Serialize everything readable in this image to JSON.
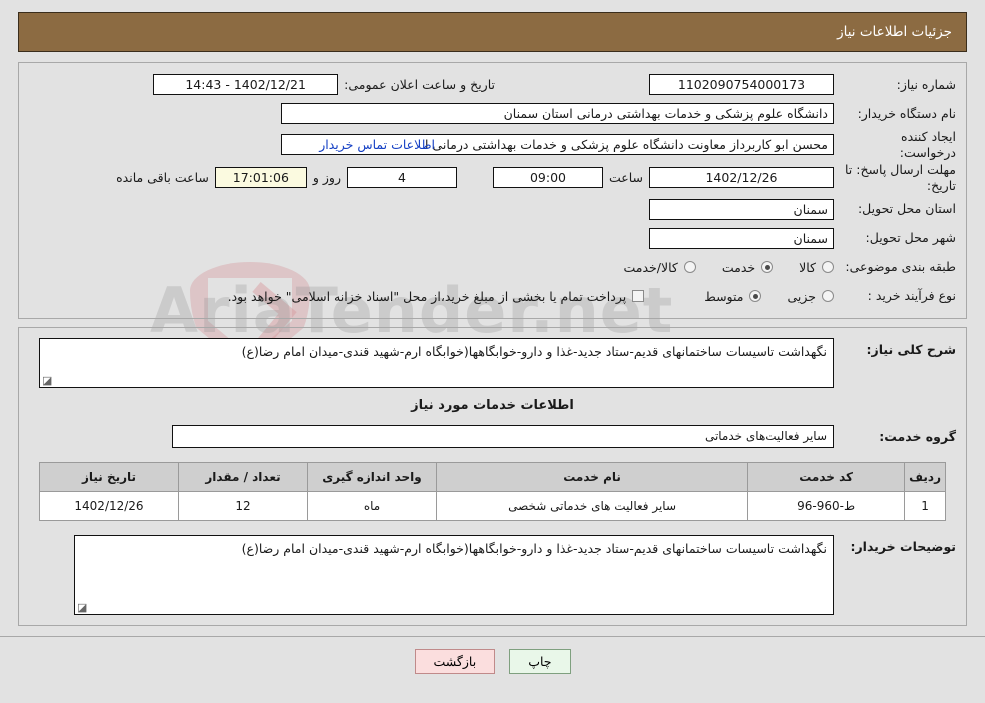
{
  "header": {
    "title": "جزئیات اطلاعات نیاز"
  },
  "top_form": {
    "need_number": {
      "label": "شماره نیاز:",
      "value": "1102090754000173"
    },
    "announce_datetime": {
      "label": "تاریخ و ساعت اعلان عمومی:",
      "value": "1402/12/21 - 14:43"
    },
    "buyer_org": {
      "label": "نام دستگاه خریدار:",
      "value": "دانشگاه علوم پزشکی و خدمات بهداشتی  درمانی استان سمنان"
    },
    "creator": {
      "label": "ایجاد کننده درخواست:",
      "value": "محسن ابو کاربرداز معاونت  دانشگاه علوم پزشکی و خدمات بهداشتی  درمانی ا",
      "contact_link": "اطلاعات تماس خریدار"
    },
    "deadline": {
      "label": "مهلت ارسال پاسخ: تا تاریخ:",
      "date": "1402/12/26",
      "time_label": "ساعت",
      "time": "09:00",
      "days": "4",
      "days_suffix": "روز و",
      "countdown": "17:01:06",
      "countdown_suffix": "ساعت باقی مانده"
    },
    "province": {
      "label": "استان محل تحویل:",
      "value": "سمنان"
    },
    "city": {
      "label": "شهر محل تحویل:",
      "value": "سمنان"
    },
    "category": {
      "label": "طبقه بندی موضوعی:",
      "options": [
        {
          "label": "کالا",
          "selected": false
        },
        {
          "label": "خدمت",
          "selected": true
        },
        {
          "label": "کالا/خدمت",
          "selected": false
        }
      ]
    },
    "process_type": {
      "label": "نوع فرآیند خرید :",
      "options": [
        {
          "label": "جزیی",
          "selected": false
        },
        {
          "label": "متوسط",
          "selected": true
        }
      ],
      "checkbox": {
        "label": "پرداخت تمام یا بخشی از مبلغ خرید،از محل \"اسناد خزانه اسلامی\" خواهد بود.",
        "checked": false
      }
    }
  },
  "middle": {
    "general_description": {
      "label": "شرح کلی نیاز:",
      "value": "نگهداشت تاسیسات ساختمانهای قدیم-ستاد جدید-غذا و دارو-خوابگاهها(خوابگاه ارم-شهید قندی-میدان امام رضا(ع)"
    },
    "services_heading": "اطلاعات خدمات مورد نیاز",
    "service_group": {
      "label": "گروه خدمت:",
      "value": "سایر فعالیت‌های خدماتی"
    },
    "table": {
      "columns": [
        "ردیف",
        "کد خدمت",
        "نام خدمت",
        "واحد اندازه گیری",
        "تعداد / مقدار",
        "تاریخ نیاز"
      ],
      "rows": [
        {
          "radif": "1",
          "code": "ط-960-96",
          "name": "سایر فعالیت های خدماتی شخصی",
          "unit": "ماه",
          "qty": "12",
          "date": "1402/12/26"
        }
      ]
    },
    "buyer_notes": {
      "label": "توضیحات خریدار:",
      "value": "نگهداشت تاسیسات ساختمانهای قدیم-ستاد جدید-غذا و دارو-خوابگاهها(خوابگاه ارم-شهید قندی-میدان امام رضا(ع)"
    }
  },
  "footer": {
    "print_label": "چاپ",
    "back_label": "بازگشت"
  },
  "watermark": {
    "text": "AriaTender.net"
  }
}
